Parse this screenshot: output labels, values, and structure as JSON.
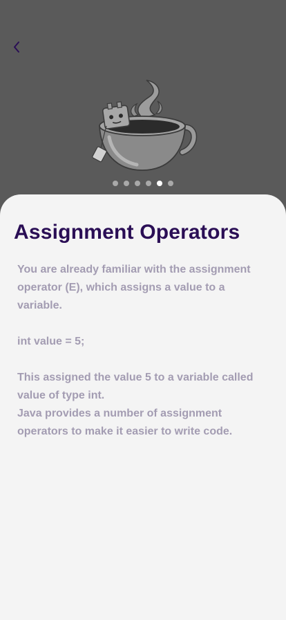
{
  "header": {
    "back_icon": "chevron-left-icon"
  },
  "illustration": {
    "icon": "tea-cup-robot-illustration"
  },
  "pagination": {
    "total": 6,
    "active_index": 4
  },
  "lesson": {
    "title": "Assignment Operators",
    "p1": "You are already familiar with the assignment operator (E), which assigns a value to a variable.",
    "code": "int value = 5;",
    "p2": "This assigned the value 5 to a variable called value of type int.",
    "p3": "Java provides a number of assignment operators to make it easier to write code."
  },
  "colors": {
    "title": "#2a0e55",
    "body_text": "#a39cb2",
    "overlay": "#5a5a5a",
    "sheet": "#f4f4f4",
    "back_icon": "#2a0e55"
  }
}
